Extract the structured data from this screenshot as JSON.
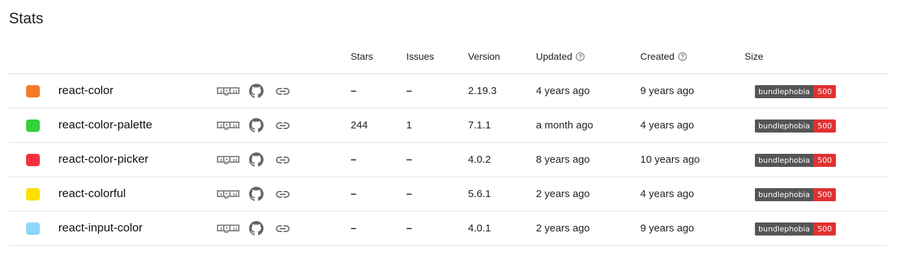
{
  "page": {
    "title": "Stats"
  },
  "headers": {
    "stars": "Stars",
    "issues": "Issues",
    "version": "Version",
    "updated": "Updated",
    "created": "Created",
    "size": "Size"
  },
  "icons": {
    "npm": "npm-icon",
    "github": "github-icon",
    "link": "link-icon",
    "help": "help-icon"
  },
  "colors": {
    "badge_left": "#555555",
    "badge_right": "#e03131"
  },
  "rows": [
    {
      "name": "react-color",
      "color": "#f47a2a",
      "stars": "–",
      "issues": "–",
      "version": "2.19.3",
      "updated": "4 years ago",
      "created": "9 years ago",
      "badge_label": "bundlephobia",
      "badge_value": "500"
    },
    {
      "name": "react-color-palette",
      "color": "#34d03a",
      "stars": "244",
      "issues": "1",
      "version": "7.1.1",
      "updated": "a month ago",
      "created": "4 years ago",
      "badge_label": "bundlephobia",
      "badge_value": "500"
    },
    {
      "name": "react-color-picker",
      "color": "#f4303e",
      "stars": "–",
      "issues": "–",
      "version": "4.0.2",
      "updated": "8 years ago",
      "created": "10 years ago",
      "badge_label": "bundlephobia",
      "badge_value": "500"
    },
    {
      "name": "react-colorful",
      "color": "#fde000",
      "stars": "–",
      "issues": "–",
      "version": "5.6.1",
      "updated": "2 years ago",
      "created": "4 years ago",
      "badge_label": "bundlephobia",
      "badge_value": "500"
    },
    {
      "name": "react-input-color",
      "color": "#8ed6fb",
      "stars": "–",
      "issues": "–",
      "version": "4.0.1",
      "updated": "2 years ago",
      "created": "9 years ago",
      "badge_label": "bundlephobia",
      "badge_value": "500"
    }
  ]
}
